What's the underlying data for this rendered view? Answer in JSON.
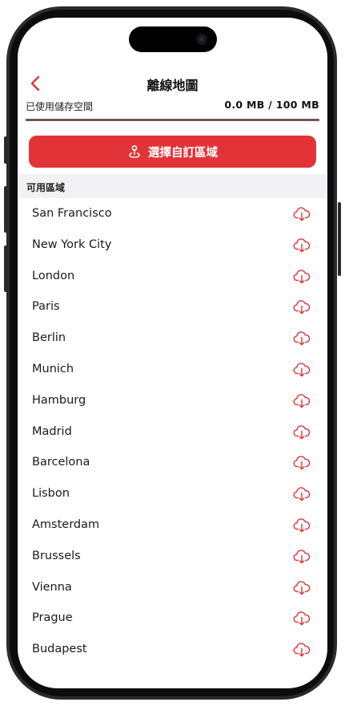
{
  "nav": {
    "title": "離線地圖",
    "back_icon": "chevron-left-icon"
  },
  "storage": {
    "label": "已使用儲存空間",
    "value": "0.0 MB / 100 MB",
    "used_fraction": 0.0
  },
  "custom_region": {
    "label": "選擇自訂區域",
    "icon": "location-pin-icon"
  },
  "section": {
    "title": "可用區域"
  },
  "regions": [
    "San Francisco",
    "New York City",
    "London",
    "Paris",
    "Berlin",
    "Munich",
    "Hamburg",
    "Madrid",
    "Barcelona",
    "Lisbon",
    "Amsterdam",
    "Brussels",
    "Vienna",
    "Prague",
    "Budapest"
  ],
  "row_icon": "cloud-download-icon",
  "colors": {
    "accent": "#e23338",
    "bar_track": "#6f5953",
    "section_bg": "#f2f2f5"
  }
}
